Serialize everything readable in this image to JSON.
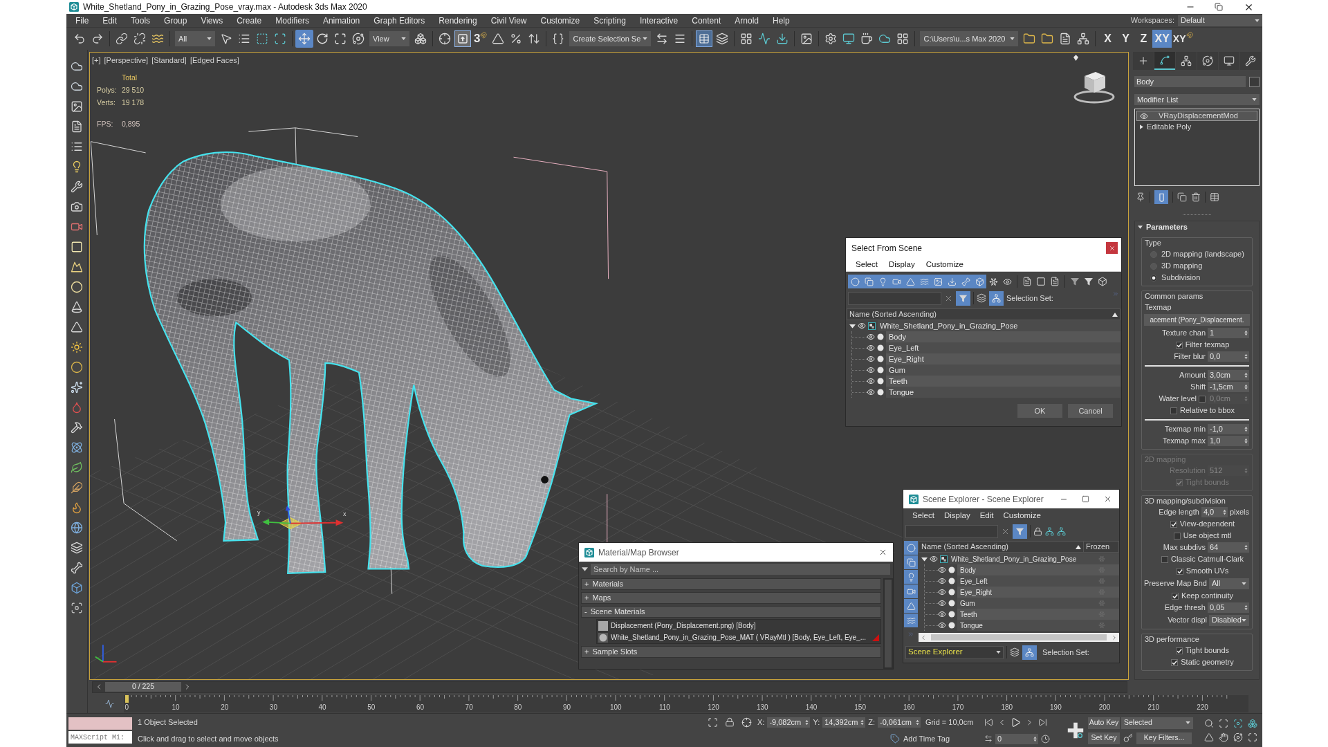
{
  "window": {
    "title": "White_Shetland_Pony_in_Grazing_Pose_vray.max - Autodesk 3ds Max 2020"
  },
  "menu": [
    "File",
    "Edit",
    "Tools",
    "Group",
    "Views",
    "Create",
    "Modifiers",
    "Animation",
    "Graph Editors",
    "Rendering",
    "Civil View",
    "Customize",
    "Scripting",
    "Interactive",
    "Content",
    "Arnold",
    "Help"
  ],
  "workspaces": {
    "label": "Workspaces:",
    "value": "Default"
  },
  "toolbar": {
    "selection_filter": "All",
    "transform_tools": [
      {
        "kind": "move",
        "selected": true
      },
      {
        "kind": "rotate",
        "selected": false
      },
      {
        "kind": "scale",
        "selected": false
      }
    ],
    "reference_coordinate": "View",
    "keyboard_override": true,
    "snaps_toggle": "3",
    "named_selection_set": "Create Selection Se",
    "scene_explorer_toggle": true,
    "project_folder": "C:\\Users\\u...s Max 2020",
    "axis_constraints": [
      {
        "label": "X",
        "selected": false
      },
      {
        "label": "Y",
        "selected": false
      },
      {
        "label": "Z",
        "selected": false
      },
      {
        "label": "XY",
        "selected": true
      }
    ],
    "axis_snap": "XY"
  },
  "viewport": {
    "active": true,
    "labels": [
      "[+]",
      "[Perspective]",
      "[Standard]",
      "[Edged Faces]"
    ],
    "stats": {
      "heading": "Total",
      "rows": [
        {
          "label": "Polys:",
          "value": "29 510"
        },
        {
          "label": "Verts:",
          "value": "19 178"
        }
      ],
      "fps_label": "FPS:",
      "fps_value": "0,895"
    },
    "gizmo_labels": [
      "y",
      "x"
    ]
  },
  "command_panel": {
    "tabs": [
      {
        "kind": "create",
        "selected": false
      },
      {
        "kind": "modify",
        "selected": true
      },
      {
        "kind": "hierarchy",
        "selected": false
      },
      {
        "kind": "motion",
        "selected": false
      },
      {
        "kind": "display",
        "selected": false
      },
      {
        "kind": "utilities",
        "selected": false
      }
    ],
    "object_name": "Body",
    "modifier_list": "Modifier List",
    "stack": [
      {
        "kind": "modifier",
        "label": "VRayDisplacementMod",
        "selected": true
      },
      {
        "kind": "object",
        "label": "Editable Poly",
        "selected": false
      }
    ],
    "show_end_result": true,
    "rollout": {
      "title": "Parameters",
      "expanded": true,
      "groups": [
        {
          "title": "Type",
          "disabled": false,
          "rows": [
            {
              "kind": "radio",
              "label": "2D mapping (landscape)",
              "selected": false
            },
            {
              "kind": "radio",
              "label": "3D mapping",
              "selected": false
            },
            {
              "kind": "radio",
              "label": "Subdivision",
              "selected": true
            }
          ]
        },
        {
          "title": "Common params",
          "disabled": false,
          "rows": [
            {
              "kind": "label",
              "label": "Texmap"
            },
            {
              "kind": "button",
              "label": "acement (Pony_Displacement."
            },
            {
              "kind": "spinner",
              "label": "Texture chan",
              "value": "1"
            },
            {
              "kind": "checkbox",
              "label": "Filter texmap",
              "checked": true
            },
            {
              "kind": "spinner",
              "label": "Filter blur",
              "value": "0,0"
            },
            {
              "kind": "separator"
            },
            {
              "kind": "spinner",
              "label": "Amount",
              "value": "3,0cm"
            },
            {
              "kind": "spinner",
              "label": "Shift",
              "value": "-1,5cm"
            },
            {
              "kind": "check_spinner",
              "label": "Water level",
              "checked": false,
              "value": "0,0cm"
            },
            {
              "kind": "checkbox",
              "label": "Relative to bbox",
              "checked": false
            },
            {
              "kind": "separator"
            },
            {
              "kind": "spinner",
              "label": "Texmap min",
              "value": "-1,0"
            },
            {
              "kind": "spinner",
              "label": "Texmap max",
              "value": "1,0"
            }
          ]
        },
        {
          "title": "2D mapping",
          "disabled": true,
          "rows": [
            {
              "kind": "spinner",
              "label": "Resolution",
              "value": "512"
            },
            {
              "kind": "checkbox",
              "label": "Tight bounds",
              "checked": true
            }
          ]
        },
        {
          "title": "3D mapping/subdivision",
          "disabled": false,
          "rows": [
            {
              "kind": "spinner",
              "label": "Edge length",
              "value": "4,0",
              "unit": "pixels"
            },
            {
              "kind": "checkbox",
              "label": "View-dependent",
              "checked": true
            },
            {
              "kind": "checkbox",
              "label": "Use object mtl",
              "checked": false
            },
            {
              "kind": "spinner",
              "label": "Max subdivs",
              "value": "64"
            },
            {
              "kind": "checkbox",
              "label": "Classic Catmull-Clark",
              "checked": false
            },
            {
              "kind": "checkbox",
              "label": "Smooth UVs",
              "checked": true
            },
            {
              "kind": "dropdown",
              "label": "Preserve Map Bnd",
              "value": "All"
            },
            {
              "kind": "checkbox",
              "label": "Keep continuity",
              "checked": true
            },
            {
              "kind": "spinner",
              "label": "Edge thresh",
              "value": "0,05"
            },
            {
              "kind": "dropdown",
              "label": "Vector displ",
              "value": "Disabled"
            }
          ]
        },
        {
          "title": "3D performance",
          "disabled": false,
          "rows": [
            {
              "kind": "checkbox",
              "label": "Tight bounds",
              "checked": true
            },
            {
              "kind": "checkbox",
              "label": "Static geometry",
              "checked": true
            }
          ]
        }
      ]
    }
  },
  "select_from_scene": {
    "title": "Select From Scene",
    "menu": [
      "Select",
      "Display",
      "Customize"
    ],
    "filters": [
      {
        "kind": "geometry",
        "selected": true
      },
      {
        "kind": "shapes",
        "selected": true
      },
      {
        "kind": "lights",
        "selected": true
      },
      {
        "kind": "cameras",
        "selected": true
      },
      {
        "kind": "helpers",
        "selected": true
      },
      {
        "kind": "spacewarps",
        "selected": true
      },
      {
        "kind": "groups",
        "selected": true
      },
      {
        "kind": "xrefs",
        "selected": true
      },
      {
        "kind": "bones",
        "selected": true
      },
      {
        "kind": "containers",
        "selected": true
      },
      {
        "kind": "frozen",
        "selected": false
      },
      {
        "kind": "hidden",
        "selected": false
      }
    ],
    "filter_toggle": true,
    "hierarchy_mode": true,
    "selection_set_label": "Selection Set:",
    "column": "Name (Sorted Ascending)",
    "tree": [
      {
        "name": "White_Shetland_Pony_in_Grazing_Pose",
        "expanded": true,
        "children": [
          {
            "name": "Body"
          },
          {
            "name": "Eye_Left"
          },
          {
            "name": "Eye_Right"
          },
          {
            "name": "Gum"
          },
          {
            "name": "Teeth"
          },
          {
            "name": "Tongue"
          }
        ]
      }
    ],
    "buttons": [
      "OK",
      "Cancel"
    ]
  },
  "material_browser": {
    "title": "Material/Map Browser",
    "search_placeholder": "Search by Name ...",
    "groups": [
      {
        "sign": "+",
        "label": "Materials"
      },
      {
        "sign": "+",
        "label": "Maps"
      },
      {
        "sign": "-",
        "label": "Scene Materials",
        "items": [
          {
            "kind": "map",
            "label": "Displacement (Pony_Displacement.png) [Body]"
          },
          {
            "kind": "material",
            "label": "White_Shetland_Pony_in_Grazing_Pose_MAT ( VRayMtl ) [Body, Eye_Left, Eye_..."
          }
        ]
      },
      {
        "sign": "+",
        "label": "Sample Slots"
      }
    ]
  },
  "scene_explorer": {
    "title": "Scene Explorer - Scene Explorer",
    "menu": [
      "Select",
      "Display",
      "Edit",
      "Customize"
    ],
    "filter_toggle": true,
    "filters": [
      {
        "kind": "geometry",
        "selected": true
      },
      {
        "kind": "shapes",
        "selected": true
      },
      {
        "kind": "lights",
        "selected": true
      },
      {
        "kind": "cameras",
        "selected": true
      },
      {
        "kind": "helpers",
        "selected": true
      },
      {
        "kind": "spacewarps",
        "selected": true
      }
    ],
    "columns": [
      "Name (Sorted Ascending)",
      "Frozen"
    ],
    "tree": [
      {
        "name": "White_Shetland_Pony_in_Grazing_Pose",
        "expanded": true,
        "frozen": false,
        "children": [
          {
            "name": "Body",
            "frozen": false
          },
          {
            "name": "Eye_Left",
            "frozen": false
          },
          {
            "name": "Eye_Right",
            "frozen": false
          },
          {
            "name": "Gum",
            "frozen": false
          },
          {
            "name": "Teeth",
            "frozen": false
          },
          {
            "name": "Tongue",
            "frozen": false
          }
        ]
      }
    ],
    "explorer": "Scene Explorer",
    "hierarchy_mode": true,
    "selection_set_label": "Selection Set:"
  },
  "timeline": {
    "slider": {
      "label": "0 / 225",
      "level": 0
    },
    "ticks": [
      "0",
      "10",
      "20",
      "30",
      "40",
      "50",
      "60",
      "70",
      "80",
      "90",
      "100",
      "110",
      "120",
      "130",
      "140",
      "150",
      "160",
      "170",
      "180",
      "190",
      "200",
      "210",
      "220"
    ]
  },
  "status_bar": {
    "listener": "MAXScript Mi:",
    "selection": "1 Object Selected",
    "prompt": "Click and drag to select and move objects",
    "coords": [
      {
        "axis": "X:",
        "value": "-9,082cm"
      },
      {
        "axis": "Y:",
        "value": "14,392cm"
      },
      {
        "axis": "Z:",
        "value": "-0,061cm"
      }
    ],
    "grid": "Grid = 10,0cm",
    "time_tag": "Add Time Tag",
    "frame": "0",
    "auto_key": "Auto Key",
    "key_set": "Selected",
    "set_key": "Set Key",
    "key_filters": "Key Filters..."
  }
}
